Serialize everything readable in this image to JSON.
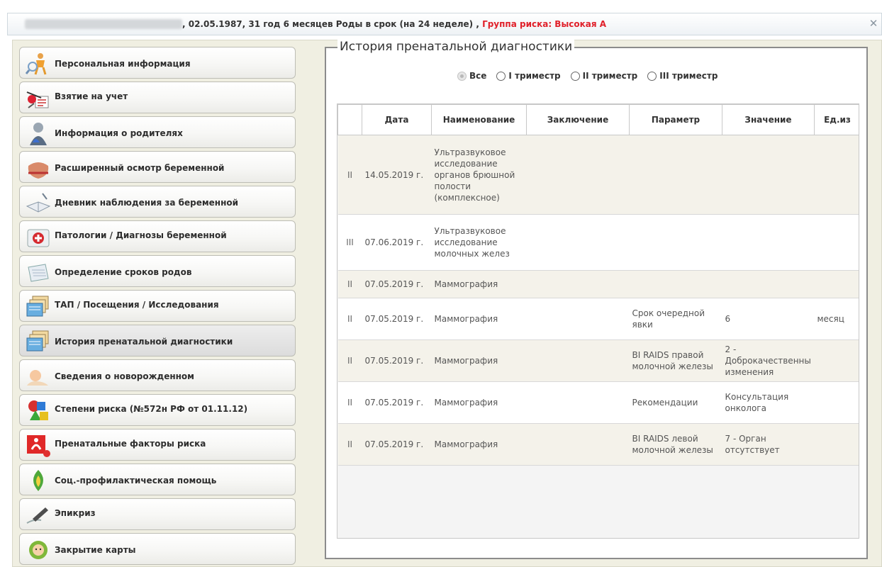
{
  "header": {
    "text": ", 02.05.1987, 31 год 6 месяцев Роды в срок (на 24 неделе) , ",
    "risk": "Группа риска: Высокая А",
    "close_glyph": "✕"
  },
  "sidebar": {
    "items": [
      {
        "label": "Персональная информация",
        "icon": "person-search-icon"
      },
      {
        "label": "Взятие на учет",
        "icon": "registration-icon"
      },
      {
        "label": "Информация о родителях",
        "icon": "parents-icon"
      },
      {
        "label": "Расширенный осмотр беременной",
        "icon": "pregnant-exam-icon"
      },
      {
        "label": "Дневник наблюдения за беременной",
        "icon": "diary-icon"
      },
      {
        "label": "Патологии / Диагнозы беременной",
        "icon": "medkit-icon"
      },
      {
        "label": "Определение сроков родов",
        "icon": "calendar-icon"
      },
      {
        "label": "ТАП / Посещения / Исследования",
        "icon": "folders-icon"
      },
      {
        "label": "История пренатальной диагностики",
        "icon": "folders-icon",
        "active": true
      },
      {
        "label": "Сведения о новорожденном",
        "icon": "newborn-icon"
      },
      {
        "label": "Степени риска (№572н РФ от 01.11.12)",
        "icon": "risk-shapes-icon"
      },
      {
        "label": "Пренатальные факторы риска",
        "icon": "risk-factors-icon"
      },
      {
        "label": "Соц.-профилактическая помощь",
        "icon": "social-help-icon"
      },
      {
        "label": "Эпикриз",
        "icon": "pen-icon"
      },
      {
        "label": "Закрытие карты",
        "icon": "baby-face-icon"
      }
    ]
  },
  "main": {
    "title": "История пренатальной диагностики",
    "filters": [
      {
        "label": "Все",
        "checked": true
      },
      {
        "label": "I триместр",
        "checked": false
      },
      {
        "label": "II триместр",
        "checked": false
      },
      {
        "label": "III триместр",
        "checked": false
      }
    ],
    "table": {
      "headers": [
        "",
        "Дата",
        "Наименование",
        "Заключение",
        "Параметр",
        "Значение",
        "Ед.из"
      ],
      "rows": [
        [
          "II",
          "14.05.2019 г.",
          "Ультразвуковое исследование органов брюшной полости (комплексное)",
          "",
          "",
          "",
          ""
        ],
        [
          "III",
          "07.06.2019 г.",
          "Ультразвуковое исследование молочных желез",
          "",
          "",
          "",
          ""
        ],
        [
          "II",
          "07.05.2019 г.",
          "Маммография",
          "",
          "",
          "",
          ""
        ],
        [
          "II",
          "07.05.2019 г.",
          "Маммография",
          "",
          "Срок очередной явки",
          "6",
          "месяц"
        ],
        [
          "II",
          "07.05.2019 г.",
          "Маммография",
          "",
          "BI RAIDS правой молочной железы",
          "2 - Доброкачественны изменения",
          ""
        ],
        [
          "II",
          "07.05.2019 г.",
          "Маммография",
          "",
          "Рекомендации",
          "Консультация онколога",
          ""
        ],
        [
          "II",
          "07.05.2019 г.",
          "Маммография",
          "",
          "BI RAIDS левой молочной железы",
          "7 - Орган отсутствует",
          ""
        ]
      ]
    }
  },
  "colors": {
    "risk": "#e0202a",
    "panel_bg": "#f0efe2",
    "row_alt": "#f4f2ea"
  }
}
